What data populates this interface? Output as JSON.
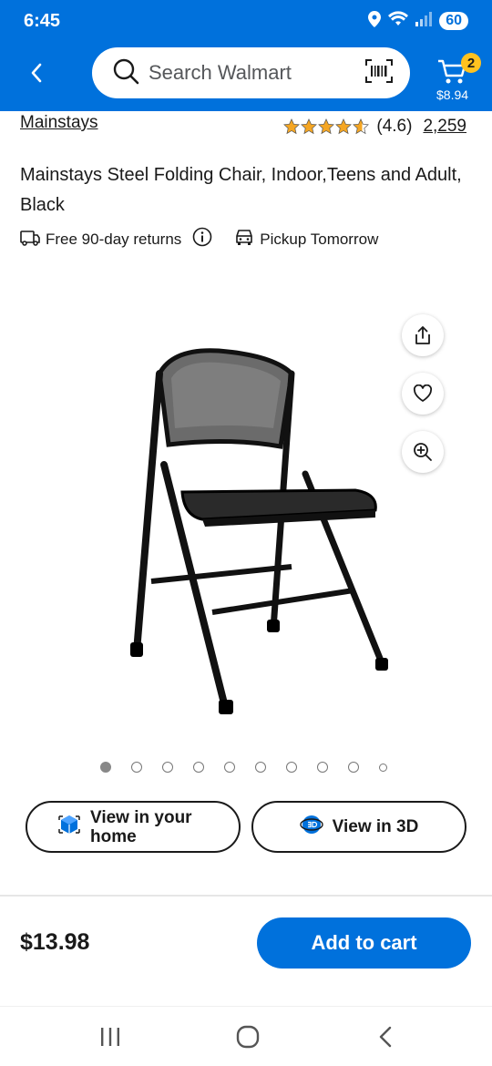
{
  "status": {
    "time": "6:45",
    "battery": "60"
  },
  "header": {
    "search_placeholder": "Search Walmart",
    "cart_count": "2",
    "cart_total": "$8.94"
  },
  "product": {
    "brand": "Mainstays",
    "rating_text": "(4.6)",
    "rating_value": 4.6,
    "review_count": "2,259",
    "title": "Mainstays Steel Folding Chair, Indoor,Teens and Adult, Black",
    "returns": "Free 90-day returns",
    "pickup": "Pickup Tomorrow",
    "image_count": 10,
    "active_image": 1
  },
  "actions": {
    "view_home": "View in your home",
    "view_3d": "View in 3D"
  },
  "footer": {
    "price": "$13.98",
    "add_to_cart": "Add to cart"
  },
  "colors": {
    "brand_blue": "#0071dc",
    "cart_badge": "#ffc220",
    "star": "#f5a623"
  }
}
